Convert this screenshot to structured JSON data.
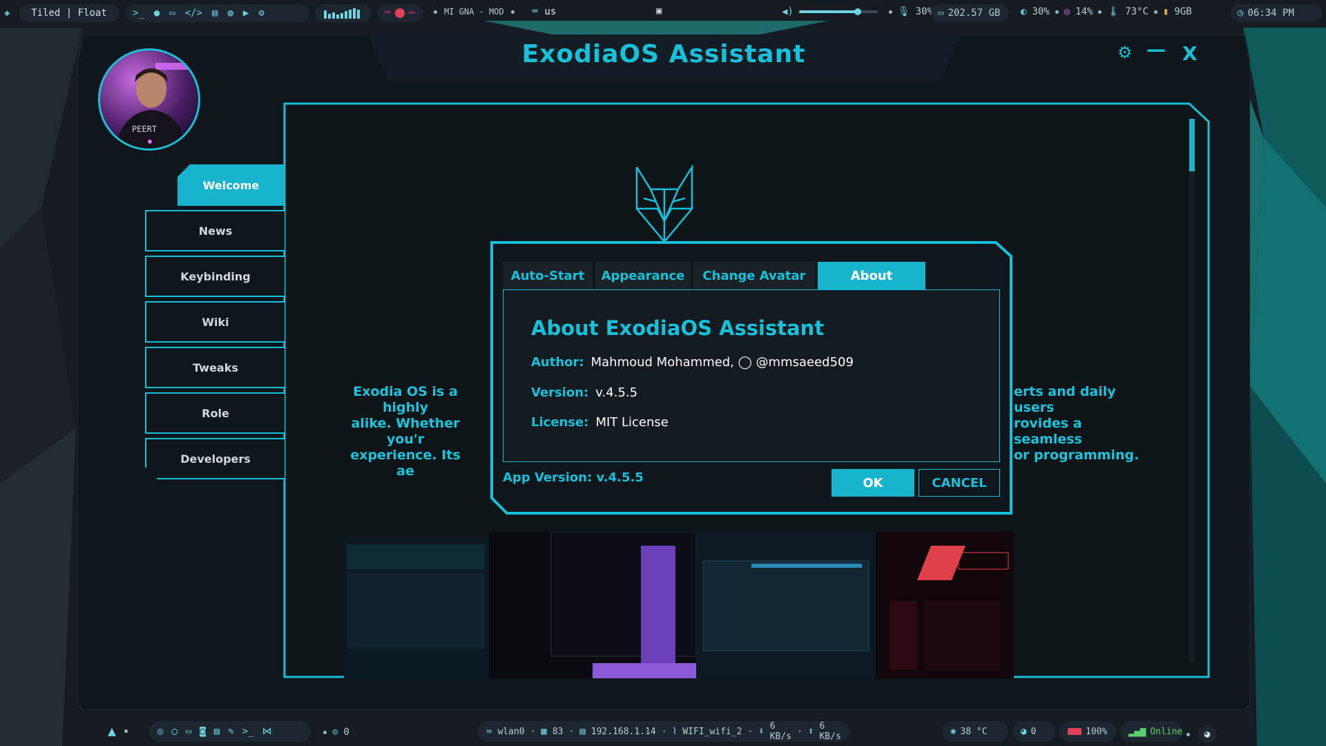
{
  "topbar": {
    "layout_label": "Tiled | Float",
    "player_text": "MI GNA - MOD",
    "keyboard_layout": "us",
    "volume": "30%",
    "volume_level": 0.75,
    "mic": "30%",
    "disk": "202.57 GB",
    "cpu": "30%",
    "memory_pct": "14%",
    "temp": "73°C",
    "ram": "9GB",
    "clock": "06:34 PM"
  },
  "window": {
    "title": "ExodiaOS Assistant",
    "controls": {
      "settings": "⚙",
      "minimize": "—",
      "close": "X"
    }
  },
  "nav": [
    {
      "label": "Welcome",
      "active": true
    },
    {
      "label": "News",
      "active": false
    },
    {
      "label": "Keybinding",
      "active": false
    },
    {
      "label": "Wiki",
      "active": false
    },
    {
      "label": "Tweaks",
      "active": false
    },
    {
      "label": "Role",
      "active": false
    },
    {
      "label": "Developers",
      "active": false
    }
  ],
  "content": {
    "desc_left": [
      "Exodia OS is a highly",
      "alike. Whether you'r",
      "experience. Its ae"
    ],
    "desc_right": [
      "erts and daily users",
      "rovides a seamless",
      "or programming."
    ]
  },
  "dialog": {
    "tabs": [
      "Auto-Start",
      "Appearance",
      "Change Avatar",
      "About"
    ],
    "selected_tab": "About",
    "heading": "About ExodiaOS Assistant",
    "author_label": "Author:",
    "author_value": "Mahmoud Mohammed, ◯ @mmsaeed509",
    "version_label": "Version:",
    "version_value": "v.4.5.5",
    "license_label": "License:",
    "license_value": "MIT License",
    "app_version": "App Version: v.4.5.5",
    "ok_label": "OK",
    "cancel_label": "CANCEL"
  },
  "bottombar": {
    "workspace_count": "0",
    "iface": "wlan0",
    "signal": "83",
    "ip": "192.168.1.14",
    "ssid": "WIFI_wifi_2",
    "down": "6 KB/s",
    "up": "6 KB/s",
    "cpu_temp": "38 °C",
    "github": "0",
    "battery": "100%",
    "status": "Online"
  },
  "colors": {
    "accent": "#18c1da",
    "accent_fill": "#18b4cd",
    "bg": "#10171c"
  }
}
